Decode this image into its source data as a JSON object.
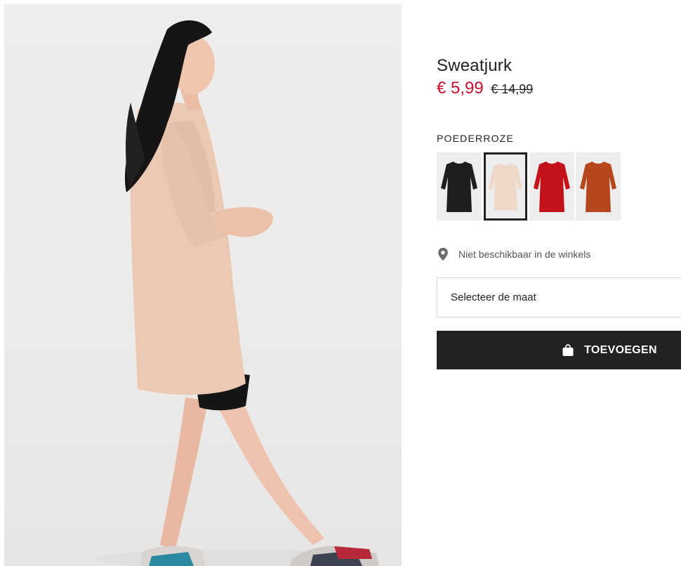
{
  "product": {
    "title": "Sweatjurk",
    "price_sale": "€ 5,99",
    "price_original": "€ 14,99",
    "color_label": "POEDERROZE",
    "colors": {
      "sale_price": "#c8102e",
      "button_bg": "#222222"
    },
    "swatches": [
      {
        "name": "black",
        "color": "#1e1e1e",
        "selected": false
      },
      {
        "name": "powder-pink",
        "color": "#eed8c8",
        "selected": true
      },
      {
        "name": "red",
        "color": "#c4121b",
        "selected": false
      },
      {
        "name": "rust",
        "color": "#b6471c",
        "selected": false
      }
    ]
  },
  "store": {
    "icon": "location-pin-icon",
    "text": "Niet beschikbaar in de winkels"
  },
  "size_select": {
    "label": "Selecteer de maat"
  },
  "add_button": {
    "icon": "shopping-bag-icon",
    "label": "TOEVOEGEN"
  }
}
